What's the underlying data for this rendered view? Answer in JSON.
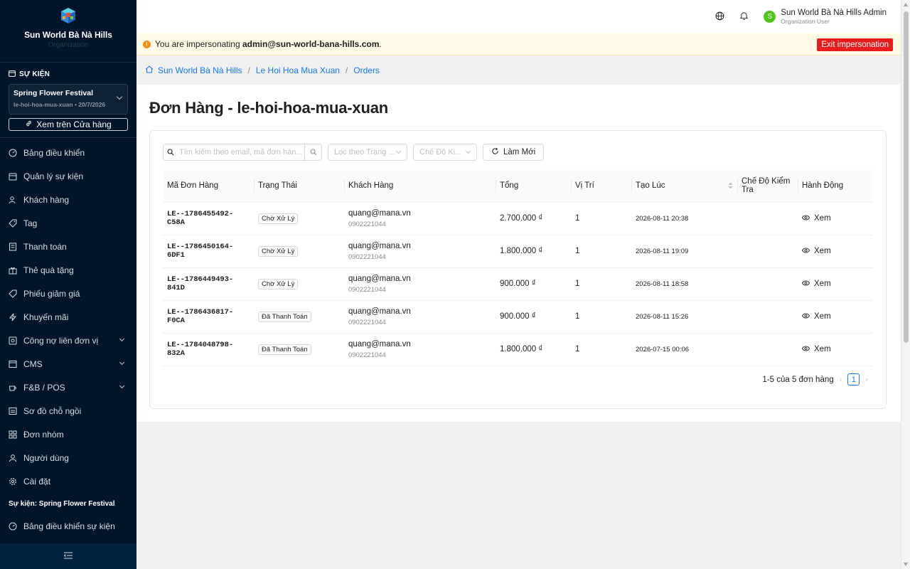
{
  "sidebar": {
    "brand_title": "Sun World Bà Nà Hills",
    "brand_subtitle": "Organization",
    "section_label": "SỰ KIỆN",
    "event": {
      "name": "Spring Flower Festival",
      "meta": "le-hoi-hoa-mua-xuan • 20/7/2026"
    },
    "store_button": "Xem trên Cửa hàng",
    "items": [
      {
        "label": "Bảng điều khiển",
        "icon": "dashboard-icon"
      },
      {
        "label": "Quản lý sự kiện",
        "icon": "calendar-icon"
      },
      {
        "label": "Khách hàng",
        "icon": "users-icon"
      },
      {
        "label": "Tag",
        "icon": "tag-icon"
      },
      {
        "label": "Thanh toán",
        "icon": "receipt-icon"
      },
      {
        "label": "Thẻ quà tặng",
        "icon": "gift-icon"
      },
      {
        "label": "Phiếu giảm giá",
        "icon": "coupon-icon"
      },
      {
        "label": "Khuyến mãi",
        "icon": "bolt-icon"
      },
      {
        "label": "Công nợ liên đơn vị",
        "icon": "ledger-icon",
        "expandable": true
      },
      {
        "label": "CMS",
        "icon": "cms-icon",
        "expandable": true
      },
      {
        "label": "F&B / POS",
        "icon": "coffee-icon",
        "expandable": true
      },
      {
        "label": "Sơ đồ chỗ ngồi",
        "icon": "seatmap-icon"
      },
      {
        "label": "Đơn nhóm",
        "icon": "grid-icon"
      },
      {
        "label": "Người dùng",
        "icon": "user-icon"
      },
      {
        "label": "Cài đặt",
        "icon": "gear-icon"
      }
    ],
    "event_section_label": "Sự kiện: Spring Flower Festival",
    "event_items": [
      {
        "label": "Bảng điều khiển sự kiện",
        "icon": "dashboard-icon"
      }
    ]
  },
  "header": {
    "user_initial": "S",
    "user_name": "Sun World Bà Nà Hills Admin",
    "user_role": "Organization User"
  },
  "impersonation": {
    "prefix": "You are impersonating ",
    "email": "admin@sun-world-bana-hills.com",
    "suffix": ".",
    "exit_label": "Exit impersonation"
  },
  "breadcrumb": {
    "home": "Sun World Bà Nà Hills",
    "event": "Le Hoi Hoa Mua Xuan",
    "current": "Orders"
  },
  "page": {
    "title": "Đơn Hàng - le-hoi-hoa-mua-xuan"
  },
  "filters": {
    "search_placeholder": "Tìm kiếm theo email, mã đơn hàn...",
    "status_placeholder": "Lọc theo Trạng ...",
    "mode_placeholder": "Chế Độ Ki...",
    "refresh_label": "Làm Mới"
  },
  "table": {
    "columns": [
      "Mã Đơn Hàng",
      "Trạng Thái",
      "Khách Hàng",
      "Tổng",
      "Vị Trí",
      "Tạo Lúc",
      "Chế Độ Kiểm Tra",
      "Hành Động"
    ],
    "rows": [
      {
        "id": "LE--1786455492-C58A",
        "status": "Chờ Xử Lý",
        "email": "quang@mana.vn",
        "phone": "0902221044",
        "total": "2.700.000 ₫",
        "position": "1",
        "created": "2026-08-11 20:38",
        "mode": "",
        "action": "Xem"
      },
      {
        "id": "LE--1786450164-6DF1",
        "status": "Chờ Xử Lý",
        "email": "quang@mana.vn",
        "phone": "0902221044",
        "total": "1.800.000 ₫",
        "position": "1",
        "created": "2026-08-11 19:09",
        "mode": "",
        "action": "Xem"
      },
      {
        "id": "LE--1786449493-841D",
        "status": "Chờ Xử Lý",
        "email": "quang@mana.vn",
        "phone": "0902221044",
        "total": "900.000 ₫",
        "position": "1",
        "created": "2026-08-11 18:58",
        "mode": "",
        "action": "Xem"
      },
      {
        "id": "LE--1786436817-F0CA",
        "status": "Đã Thanh Toán",
        "email": "quang@mana.vn",
        "phone": "0902221044",
        "total": "900.000 ₫",
        "position": "1",
        "created": "2026-08-11 15:26",
        "mode": "",
        "action": "Xem"
      },
      {
        "id": "LE--1784048798-832A",
        "status": "Đã Thanh Toán",
        "email": "quang@mana.vn",
        "phone": "0902221044",
        "total": "1.800.000 ₫",
        "position": "1",
        "created": "2026-07-15 00:06",
        "mode": "",
        "action": "Xem"
      }
    ]
  },
  "pagination": {
    "summary": "1-5 của 5 đơn hàng",
    "current_page": "1"
  },
  "colors": {
    "sidebar_bg": "#001529",
    "accent": "#1677ff",
    "danger": "#e81c1c",
    "warning_bg": "#fffbe6"
  }
}
